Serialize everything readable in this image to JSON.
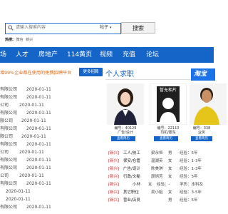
{
  "search": {
    "placeholder": "请输入搜索内容",
    "select_label": "帖子",
    "button_label": "搜索"
  },
  "hot": {
    "label": "热搜:",
    "items": [
      "微信",
      "新兴"
    ]
  },
  "nav": {
    "items": [
      "场",
      "人才",
      "房地产",
      "114黄页",
      "视频",
      "充值",
      "论坛"
    ]
  },
  "banner": {
    "text": "增99%企业都在使用的免费招聘平台",
    "button": "更多招聘"
  },
  "left_list": {
    "rows": [
      {
        "name": "有限公司",
        "date": "2020-01-11"
      },
      {
        "name": "有限公司",
        "date": "2020-01-11"
      },
      {
        "name": "公司",
        "date": "2020-01-11"
      },
      {
        "name": "有限公司",
        "date": "2020-01-11"
      },
      {
        "name": "限公司",
        "date": "2020-01-11"
      },
      {
        "name": "有限公司",
        "date": "2020-01-11"
      },
      {
        "name": "限公司",
        "date": "2020-01-11"
      },
      {
        "name": "有限公司",
        "date": "2020-01-11"
      },
      {
        "name": "公司",
        "date": "2020-01-11"
      },
      {
        "name": "有限公司",
        "date": "2020-01-11"
      },
      {
        "name": "有限公司",
        "date": "2020-01-11"
      },
      {
        "name": "公司",
        "date": "2020-01-11"
      },
      {
        "name": "有限公司",
        "date": "2020-01-11"
      },
      {
        "name": "",
        "date": "2020-01-11"
      },
      {
        "name": "",
        "date": "2020-01-11"
      },
      {
        "name": "有限公司",
        "date": "2020-01-11"
      }
    ]
  },
  "right_panel": {
    "title": "个人求职",
    "ad_text": "淘宝",
    "no_photo_text": "暂无相片",
    "cards": [
      {
        "meta": "编号：40129",
        "sub": "广告/设计",
        "view": "查看简历"
      },
      {
        "meta": "编号：22110",
        "sub": "司机/跟车",
        "view": "查看简历"
      },
      {
        "meta": "编号：338",
        "sub": "业务",
        "view": "查看简历"
      }
    ],
    "jobs": [
      {
        "tag": "[新兴]",
        "pos": "工人/技工",
        "name": "梁永恒",
        "gender": "男",
        "exp": "经验：5年",
        "extra": ""
      },
      {
        "tag": "[新兴]",
        "pos": "保安/仓管",
        "name": "温湖英",
        "gender": "女",
        "exp": "经验：1-3年",
        "extra": ""
      },
      {
        "tag": "[新兴]",
        "pos": "广告/设计",
        "name": "陈美琪",
        "gender": "女",
        "exp": "经验：1-3年",
        "extra": ""
      },
      {
        "tag": "[新兴]",
        "pos": "行政/文秘",
        "name": "颜炳芳",
        "gender": "女",
        "exp": "经验：5年",
        "extra": ""
      },
      {
        "tag": "[新兴]",
        "pos": "",
        "name": "小林",
        "gender": "女",
        "exp": "经验：-",
        "extra": "学历：本科及"
      },
      {
        "tag": "[新兴]",
        "pos": "其它职位",
        "name": "吴小姐",
        "gender": "女",
        "exp": "经验：3-5年",
        "extra": ""
      },
      {
        "tag": "[新兴]",
        "pos": "营业/店员",
        "name": "",
        "gender": "男",
        "exp": "经验：5年",
        "extra": ""
      }
    ]
  }
}
